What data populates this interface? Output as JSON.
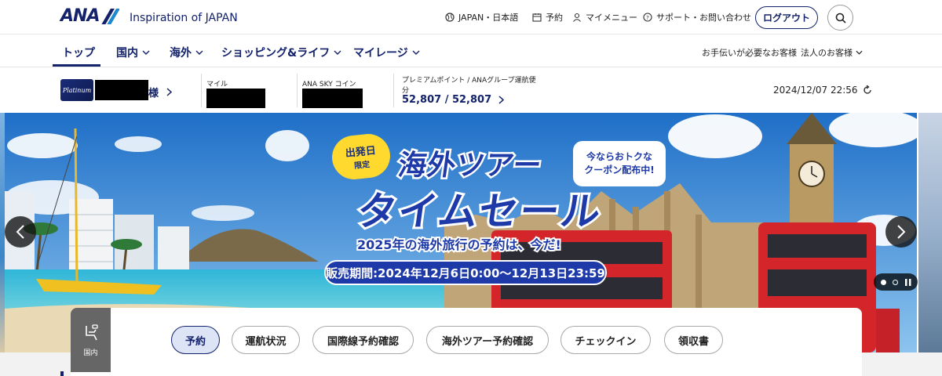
{
  "header": {
    "logo_text": "ANA",
    "tagline": "Inspiration of JAPAN",
    "utility": {
      "region": "JAPAN・日本語",
      "booking": "予約",
      "my_menu": "マイメニュー",
      "support": "サポート・お問い合わせ"
    },
    "logout_label": "ログアウト"
  },
  "nav": {
    "items": [
      {
        "label": "トップ"
      },
      {
        "label": "国内"
      },
      {
        "label": "海外"
      },
      {
        "label": "ショッピング&ライフ"
      },
      {
        "label": "マイレージ"
      }
    ],
    "right": {
      "assist": "お手伝いが必要なお客様",
      "corporate": "法人のお客様"
    }
  },
  "member": {
    "honorific": "様",
    "miles_label": "マイル",
    "coin_label": "ANA SKY コイン",
    "premium_label": "プレミアムポイント / ANAグループ運航便",
    "premium_label_2": "分",
    "premium_value": "52,807 / 52,807",
    "timestamp": "2024/12/07 22:56"
  },
  "hero": {
    "badge_line1": "出発日",
    "badge_line2": "限定",
    "title_line1": "海外ツアー",
    "title_line2": "タイムセール",
    "subtitle": "2025年の海外旅行の予約は、今だ!",
    "period": "販売期間:2024年12月6日0:00〜12月13日23:59",
    "coupon_line1": "今ならおトクな",
    "coupon_line2": "クーポン配布中!"
  },
  "quick_menu": {
    "tab_label": "国内",
    "pills": [
      {
        "label": "予約"
      },
      {
        "label": "運航状況"
      },
      {
        "label": "国際線予約確認"
      },
      {
        "label": "海外ツアー予約確認"
      },
      {
        "label": "チェックイン"
      },
      {
        "label": "領収書"
      }
    ]
  },
  "colors": {
    "brand_navy": "#13226b",
    "banner_blue": "#1e3aa8",
    "badge_yellow": "#ffd92e"
  }
}
